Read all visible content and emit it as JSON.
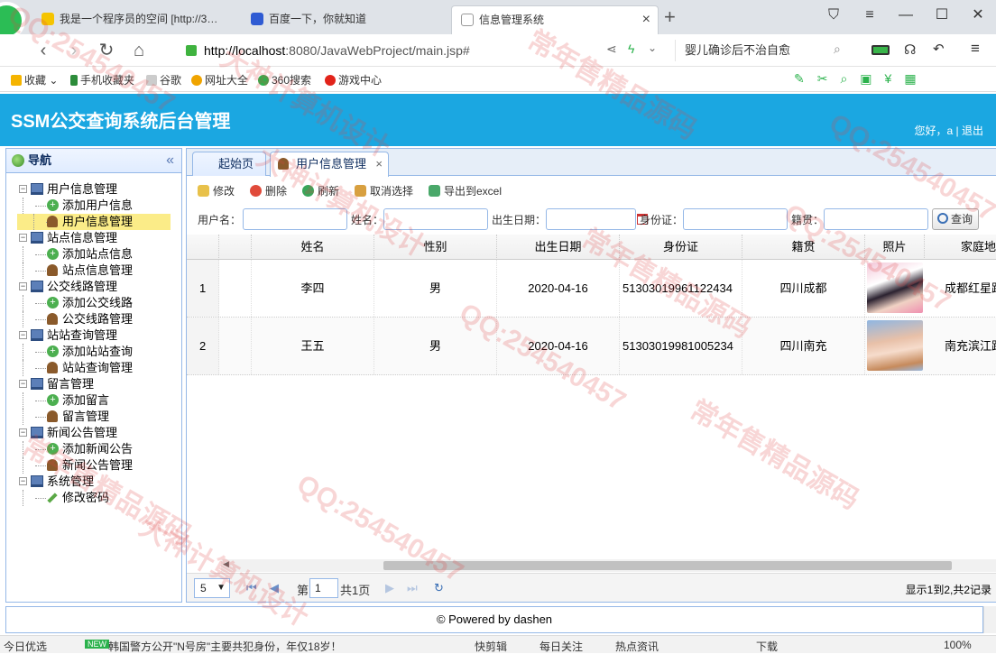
{
  "browser": {
    "tabs": [
      {
        "title": "我是一个程序员的空间 [http://3…"
      },
      {
        "title": "百度一下，你就知道"
      },
      {
        "title": "信息管理系统"
      }
    ],
    "new_tab": "+",
    "url_host": "http://localhost",
    "url_rest": ":8080/JavaWebProject/main.jsp#",
    "search_text": "婴儿确诊后不治自愈"
  },
  "bookmarks": [
    {
      "label": "收藏",
      "color": "#f5b400"
    },
    {
      "label": "手机收藏夹",
      "color": "#2c8c3a"
    },
    {
      "label": "谷歌",
      "color": "#999999"
    },
    {
      "label": "网址大全",
      "color": "#f0a400"
    },
    {
      "label": "360搜索",
      "color": "#2bb24c"
    },
    {
      "label": "游戏中心",
      "color": "#e2231a"
    }
  ],
  "app": {
    "title": "SSM公交查询系统后台管理",
    "welcome": "您好，a | 退出"
  },
  "nav": {
    "title": "导航",
    "collapse": "«",
    "groups": [
      {
        "label": "用户信息管理",
        "items": [
          "添加用户信息",
          "用户信息管理"
        ]
      },
      {
        "label": "站点信息管理",
        "items": [
          "添加站点信息",
          "站点信息管理"
        ]
      },
      {
        "label": "公交线路管理",
        "items": [
          "添加公交线路",
          "公交线路管理"
        ]
      },
      {
        "label": "站站查询管理",
        "items": [
          "添加站站查询",
          "站站查询管理"
        ]
      },
      {
        "label": "留言管理",
        "items": [
          "添加留言",
          "留言管理"
        ]
      },
      {
        "label": "新闻公告管理",
        "items": [
          "添加新闻公告",
          "新闻公告管理"
        ]
      },
      {
        "label": "系统管理",
        "items": [
          "修改密码"
        ]
      }
    ]
  },
  "tabs": {
    "home": "起始页",
    "user_manage": "用户信息管理",
    "close": "×"
  },
  "toolbar": {
    "edit": "修改",
    "delete": "删除",
    "refresh": "刷新",
    "cancel_select": "取消选择",
    "export": "导出到excel"
  },
  "filters": {
    "username_label": "用户名：",
    "name_label": "姓名：",
    "birth_label": "出生日期：",
    "idcard_label": "身份证：",
    "hometown_label": "籍贯：",
    "query_button": "查询"
  },
  "grid": {
    "columns": [
      "姓名",
      "性别",
      "出生日期",
      "身份证",
      "籍贯",
      "照片",
      "家庭地"
    ],
    "rows": [
      {
        "num": "1",
        "name": "李四",
        "gender": "男",
        "birth": "2020-04-16",
        "idcard": "51303019961122434",
        "hometown": "四川成都",
        "address": "成都红星路"
      },
      {
        "num": "2",
        "name": "王五",
        "gender": "男",
        "birth": "2020-04-16",
        "idcard": "51303019981005234",
        "hometown": "四川南充",
        "address": "南充滨江路"
      }
    ]
  },
  "pager": {
    "page_size": "5",
    "page_prefix": "第",
    "page_value": "1",
    "page_suffix": "共1页",
    "info": "显示1到2,共2记录"
  },
  "footer": {
    "text": "© Powered by dashen"
  },
  "statusbar": {
    "left": "今日优选",
    "news_badge": "NEW",
    "news": "韩国警方公开\"N号房\"主要共犯身份，年仅18岁！",
    "items": [
      "快剪辑",
      "每日关注",
      "热点资讯",
      "下载"
    ],
    "zoom": "100%"
  },
  "watermarks": [
    "QQ:254540457",
    "大神计算机设计",
    "常年售精品源码",
    "QQ:254540457",
    "大神计算机设计",
    "常年售精品源码",
    "QQ:254540457",
    "常年售精品源码",
    "大神计算机设计",
    "QQ:254540457",
    "常年售精品源码",
    "QQ:254540457"
  ]
}
